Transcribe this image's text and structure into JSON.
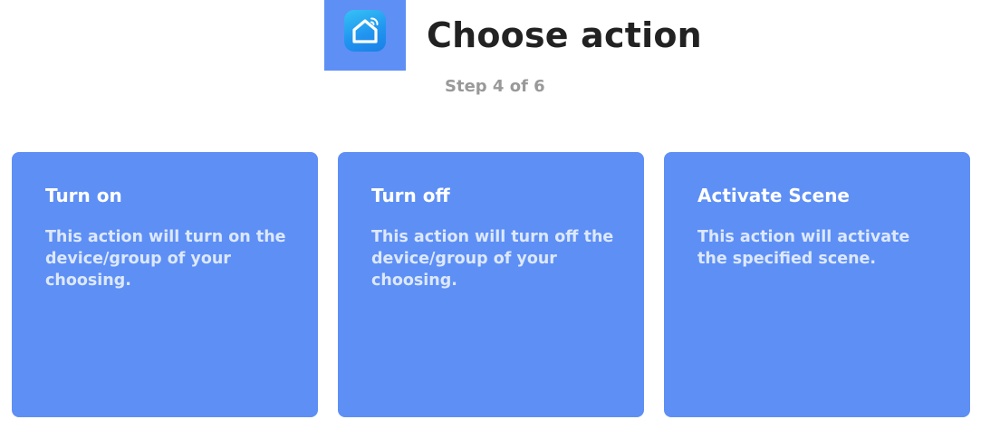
{
  "header": {
    "logo_icon": "smart-home-app-icon",
    "title": "Choose action",
    "step": "Step 4 of 6"
  },
  "actions": [
    {
      "title": "Turn on",
      "description": "This action will turn on the device/group of your choosing."
    },
    {
      "title": "Turn off",
      "description": "This action will turn off the device/group of your choosing."
    },
    {
      "title": "Activate Scene",
      "description": "This action will activate the specified scene."
    }
  ],
  "colors": {
    "card_background": "#5e8ff5",
    "title_text": "#222222",
    "step_text": "#999999"
  }
}
